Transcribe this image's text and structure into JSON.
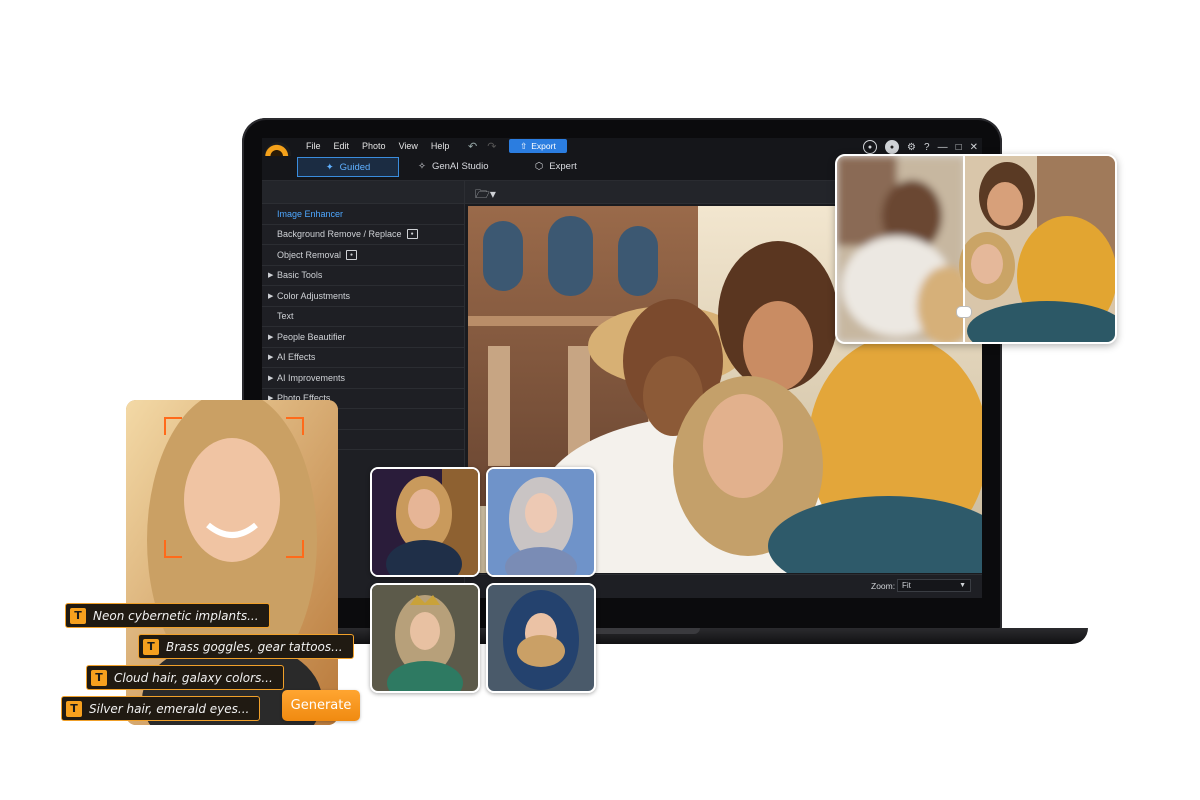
{
  "menu": [
    "File",
    "Edit",
    "Photo",
    "View",
    "Help"
  ],
  "export_label": "Export",
  "modes": {
    "guided": "Guided",
    "genai": "GenAI Studio",
    "expert": "Expert"
  },
  "leftpanel": {
    "items": [
      {
        "label": "Image Enhancer",
        "active": true
      },
      {
        "label": "Background Remove / Replace",
        "badge": true
      },
      {
        "label": "Object Removal",
        "badge": true
      },
      {
        "label": "Basic Tools",
        "expandable": true
      },
      {
        "label": "Color Adjustments",
        "expandable": true
      },
      {
        "label": "Text"
      },
      {
        "label": "People Beautifier",
        "expandable": true
      },
      {
        "label": "AI Effects",
        "expandable": true
      },
      {
        "label": "AI Improvements",
        "expandable": true
      },
      {
        "label": "Photo Effects",
        "expandable": true
      }
    ]
  },
  "zoom": {
    "label": "Zoom:",
    "value": "Fit"
  },
  "prompts": [
    "Neon cybernetic implants...",
    "Brass goggles, gear tattoos...",
    "Cloud hair, galaxy colors...",
    "Silver hair, emerald eyes..."
  ],
  "generate_label": "Generate",
  "colors": {
    "accent_blue": "#2b7de0",
    "accent_orange": "#f6a01e",
    "active_tab": "#5fb0ff"
  }
}
